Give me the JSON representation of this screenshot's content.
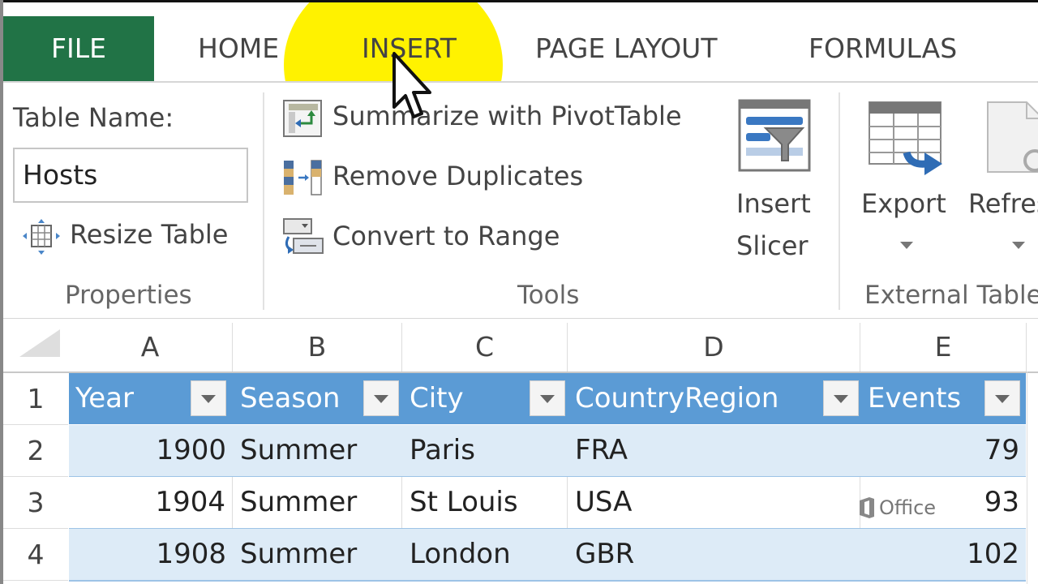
{
  "ribbon_tabs": [
    {
      "label": "FILE",
      "active": true
    },
    {
      "label": "HOME"
    },
    {
      "label": "INSERT"
    },
    {
      "label": "PAGE LAYOUT"
    },
    {
      "label": "FORMULAS"
    }
  ],
  "properties_group": {
    "table_name_label": "Table Name:",
    "table_name_value": "Hosts",
    "resize_table_label": "Resize Table",
    "group_label": "Properties"
  },
  "tools_group": {
    "summarize_label": "Summarize with PivotTable",
    "remove_duplicates_label": "Remove Duplicates",
    "convert_to_range_label": "Convert to Range",
    "insert_slicer_line1": "Insert",
    "insert_slicer_line2": "Slicer",
    "group_label": "Tools"
  },
  "external_group": {
    "export_label": "Export",
    "refresh_label": "Refres",
    "group_label": "External Table"
  },
  "sheet": {
    "columns": [
      "A",
      "B",
      "C",
      "D",
      "E"
    ],
    "row_numbers": [
      "1",
      "2",
      "3",
      "4"
    ],
    "headers": [
      "Year",
      "Season",
      "City",
      "CountryRegion",
      "Events"
    ],
    "rows": [
      [
        "1900",
        "Summer",
        "Paris",
        "FRA",
        "79"
      ],
      [
        "1904",
        "Summer",
        "St Louis",
        "USA",
        "93"
      ],
      [
        "1908",
        "Summer",
        "London",
        "GBR",
        "102"
      ]
    ]
  },
  "watermark": "Office",
  "colors": {
    "file_tab": "#217346",
    "table_header": "#5b9bd5",
    "banded_row": "#ddebf7",
    "highlight": "#fff200"
  }
}
